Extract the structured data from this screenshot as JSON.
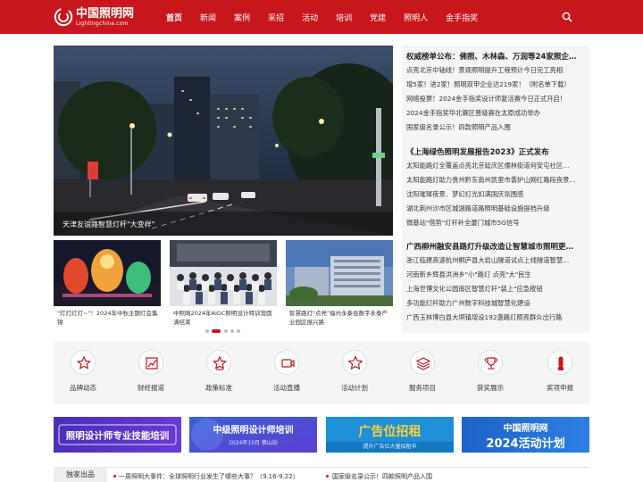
{
  "header": {
    "logo": {
      "name": "中国照明网",
      "sub": "Lightingchina.com"
    },
    "nav": [
      {
        "label": "首页",
        "active": true
      },
      {
        "label": "新闻"
      },
      {
        "label": "案例"
      },
      {
        "label": "采招"
      },
      {
        "label": "活动"
      },
      {
        "label": "培训"
      },
      {
        "label": "党建"
      },
      {
        "label": "照明人"
      },
      {
        "label": "金手指奖"
      }
    ],
    "search_icon": "search-icon"
  },
  "hero": {
    "caption": "天津友谊路智慧灯杆\"大变样\""
  },
  "thumbs": [
    {
      "caption": "\"灯灯灯灯~\"！2024年中秋主题灯会集锦"
    },
    {
      "caption": "中照网2024年AIGC照明设计特训营圆满结束"
    },
    {
      "caption": "智慧路灯\"点亮\"福州永泰县数字永泰产业园区振兴路"
    }
  ],
  "carousel": {
    "count": 5,
    "active": 1
  },
  "right": {
    "section1": {
      "title": "权威榜单公布：佛照、木林森、万润等24家照企…",
      "items": [
        "点亮北京中轴线！景观照明提升工程预计今日完工亮相",
        "增5家！进2家！照明双甲企业达219家！（附名单下载）",
        "网络投票！2024金手指奖设计师复活赛今日正式开启！",
        "2024金手指奖华北赛区晋级赛在太原成功举办",
        "国家级名录公示！四款照明产品入围"
      ]
    },
    "section2": {
      "title": "《上海绿色照明发展报告2023》正式发布",
      "items": [
        "太阳能路灯全覆盖点亮北京延庆区儒林街道何安屯社区…",
        "太阳能路灯助力贵州黔东南州凯里市香炉山网红路段夜景…",
        "沈阳璀璨夜景、梦幻灯光扣满国庆氛围感",
        "湖北荆州沙市区城湖路道路照明基础设施提档升级",
        "微基站\"借势\"灯杆补全厦门城市5G信号"
      ]
    },
    "section3": {
      "title": "广西柳州融安县路灯升级改造让智慧城市照明更…",
      "items": [
        "浙江临建高速杭州桐庐县大岩山隧道试点上线隧道智慧…",
        "河南新乡辉县洪洲乡\"小\"路灯 点亮\"大\"民生",
        "上海世博文化公园南区智慧灯杆\"装上\"应急按钮",
        "多功能灯杆助力广州数字科技城智慧化建设",
        "广西玉林博白县大垌镇增设192盏路灯照亮群众出行路"
      ]
    }
  },
  "services": [
    {
      "label": "品牌动态",
      "icon": "star-badge-icon"
    },
    {
      "label": "财经报道",
      "icon": "chart-icon"
    },
    {
      "label": "政策标准",
      "icon": "star-icon"
    },
    {
      "label": "活动直播",
      "icon": "video-icon"
    },
    {
      "label": "活动计划",
      "icon": "star-icon"
    },
    {
      "label": "服务项目",
      "icon": "layers-icon"
    },
    {
      "label": "获奖展示",
      "icon": "trophy-icon"
    },
    {
      "label": "奖项申报",
      "icon": "thumb-icon"
    }
  ],
  "banners": [
    {
      "text": "照明设计师专业技能培训"
    },
    {
      "text": "中级照明设计师培训",
      "sub": "2024年10月    佛山站"
    },
    {
      "text": "广告位招租",
      "sub": "提升广告位大量招租中"
    },
    {
      "text": "中国照明网",
      "sub": "2024活动计划"
    }
  ],
  "bottom": {
    "tag": "独家出品",
    "items": [
      "一周照明大事件：全球照明行业发生了哪些大事？（9.16-9.22）",
      "国家级名录公示！四款照明产品入围"
    ]
  },
  "colors": {
    "brand": "#c8161d",
    "panel": "#f5f5f5"
  }
}
